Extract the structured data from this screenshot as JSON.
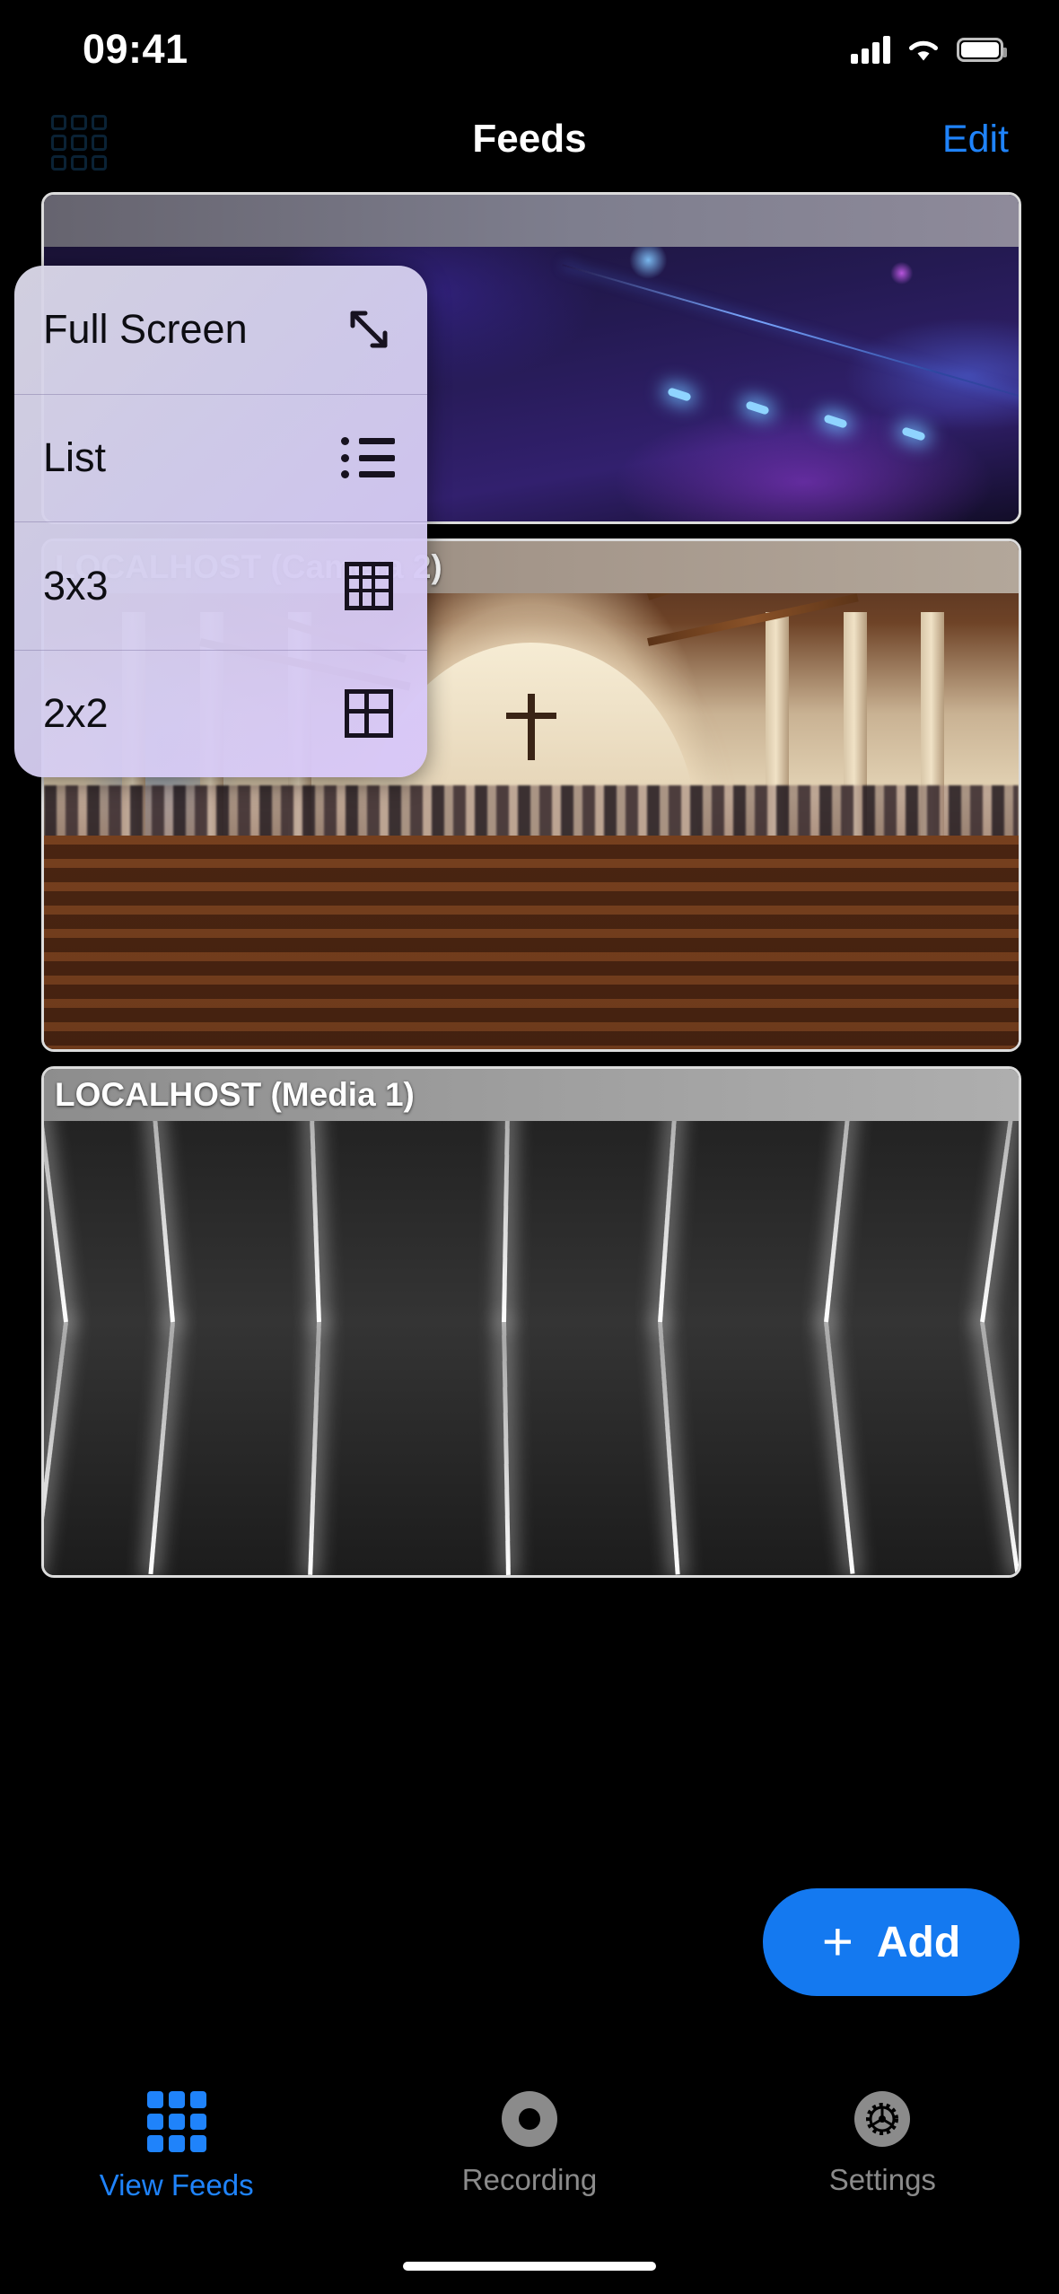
{
  "status_bar": {
    "time": "09:41",
    "signal_icon": "cellular-signal-icon",
    "wifi_icon": "wifi-icon",
    "battery_icon": "battery-icon"
  },
  "nav_bar": {
    "grid_icon": "grid-layout-icon",
    "title": "Feeds",
    "edit_label": "Edit"
  },
  "layout_menu": {
    "visible": true,
    "items": [
      {
        "label": "Full Screen",
        "icon": "expand-diagonal-arrows-icon"
      },
      {
        "label": "List",
        "icon": "bulleted-list-icon"
      },
      {
        "label": "3x3",
        "icon": "grid-3x3-icon"
      },
      {
        "label": "2x2",
        "icon": "grid-2x2-icon"
      }
    ]
  },
  "feeds": [
    {
      "label": "",
      "scene": "concert-stage"
    },
    {
      "label": "LOCALHOST (Camera 2)",
      "scene": "church-interior"
    },
    {
      "label": "LOCALHOST (Media 1)",
      "scene": "neon-pattern"
    }
  ],
  "add_button": {
    "plus": "+",
    "label": "Add",
    "color": "#1479f0"
  },
  "tab_bar": {
    "items": [
      {
        "label": "View Feeds",
        "icon": "grid-feeds-icon",
        "active": true
      },
      {
        "label": "Recording",
        "icon": "record-circle-icon",
        "active": false
      },
      {
        "label": "Settings",
        "icon": "gear-icon",
        "active": false
      }
    ],
    "active_color": "#1f83fb",
    "inactive_color": "#8b8b8b"
  }
}
